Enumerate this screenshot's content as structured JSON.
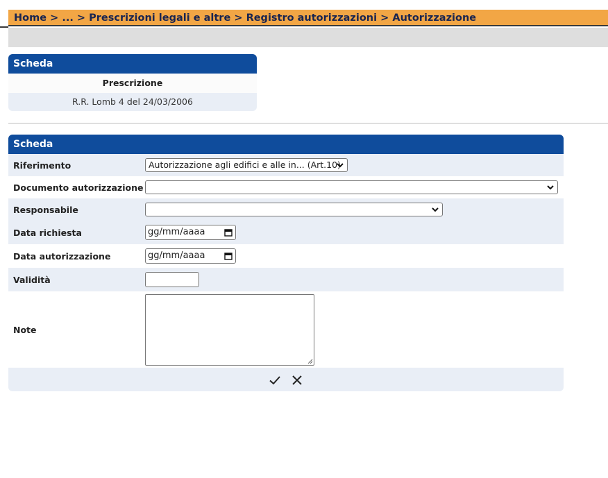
{
  "breadcrumb": {
    "items": [
      "Home",
      "...",
      "Prescrizioni legali e altre",
      "Registro autorizzazioni",
      "Autorizzazione"
    ],
    "separator": ">"
  },
  "summary_card": {
    "title": "Scheda",
    "column_header": "Prescrizione",
    "value": "R.R. Lomb 4 del 24/03/2006"
  },
  "form_card": {
    "title": "Scheda",
    "fields": {
      "riferimento": {
        "label": "Riferimento",
        "value": "Autorizzazione agli edifici e alle in... (Art.10)"
      },
      "documento": {
        "label": "Documento autorizzazione",
        "value": ""
      },
      "responsabile": {
        "label": "Responsabile",
        "value": ""
      },
      "data_richiesta": {
        "label": "Data richiesta",
        "value": "gg/mm/aaaa"
      },
      "data_autorizzazione": {
        "label": "Data autorizzazione",
        "value": "gg/mm/aaaa"
      },
      "validita": {
        "label": "Validità",
        "value": ""
      },
      "note": {
        "label": "Note",
        "value": ""
      }
    },
    "actions": {
      "confirm_icon": "check-icon",
      "cancel_icon": "close-icon"
    }
  },
  "colors": {
    "breadcrumb_bg": "#f2a645",
    "breadcrumb_text": "#1a2550",
    "card_header": "#0f4c9c",
    "row_alt": "#e9eef6",
    "toolbar_bg": "#dedede"
  }
}
